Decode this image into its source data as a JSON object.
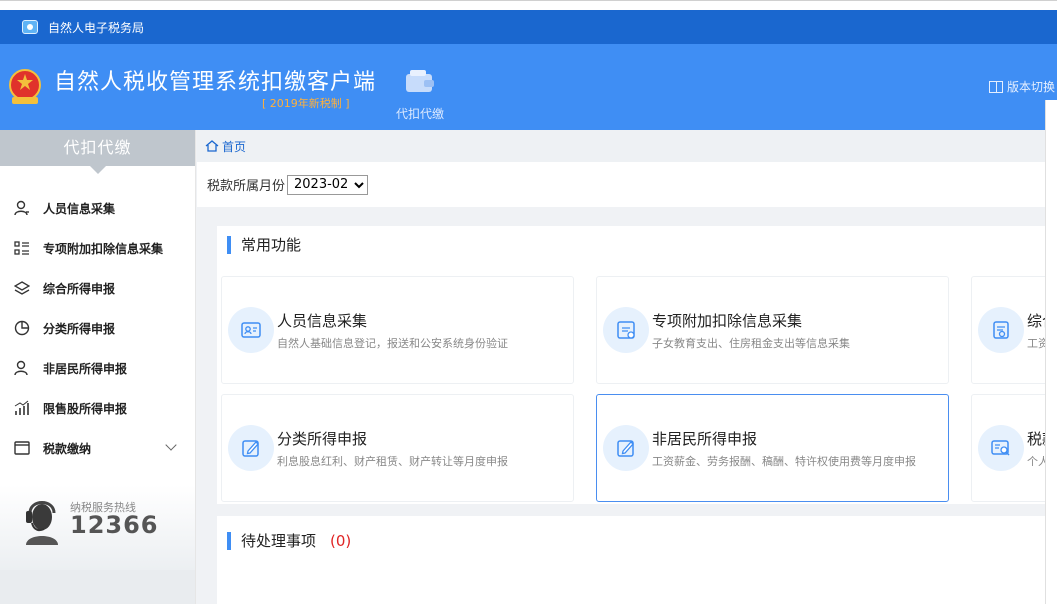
{
  "app": {
    "window_title": "自然人电子税务局"
  },
  "header": {
    "title": "自然人税收管理系统扣缴客户端",
    "subtitle": "[ 2019年新税制 ]",
    "nav_tile": "代扣代缴",
    "version_switch": "版本切换"
  },
  "sidebar": {
    "heading": "代扣代缴",
    "items": [
      {
        "label": "人员信息采集",
        "icon": "person-icon"
      },
      {
        "label": "专项附加扣除信息采集",
        "icon": "list-icon"
      },
      {
        "label": "综合所得申报",
        "icon": "layers-icon"
      },
      {
        "label": "分类所得申报",
        "icon": "pie-icon"
      },
      {
        "label": "非居民所得申报",
        "icon": "foreigner-icon"
      },
      {
        "label": "限售股所得申报",
        "icon": "bar-chart-icon"
      },
      {
        "label": "税款缴纳",
        "icon": "window-icon"
      }
    ],
    "hotline": {
      "label": "纳税服务热线",
      "number": "12366"
    }
  },
  "breadcrumb": {
    "home": "首页"
  },
  "filter": {
    "label": "税款所属月份",
    "selected": "2023-02"
  },
  "common": {
    "title": "常用功能",
    "cards": [
      {
        "title": "人员信息采集",
        "desc": "自然人基础信息登记，报送和公安系统身份验证"
      },
      {
        "title": "专项附加扣除信息采集",
        "desc": "子女教育支出、住房租金支出等信息采集"
      },
      {
        "title": "综合",
        "desc": "工资"
      },
      {
        "title": "分类所得申报",
        "desc": "利息股息红利、财产租赁、财产转让等月度申报"
      },
      {
        "title": "非居民所得申报",
        "desc": "工资薪金、劳务报酬、稿酬、特许权使用费等月度申报"
      },
      {
        "title": "税款",
        "desc": "个人"
      }
    ]
  },
  "pending": {
    "title": "待处理事项",
    "count": "(0)"
  },
  "colors": {
    "primary": "#1a67cf",
    "header": "#3f8ef4",
    "accent": "#ffb03b",
    "alert": "#e02424"
  }
}
